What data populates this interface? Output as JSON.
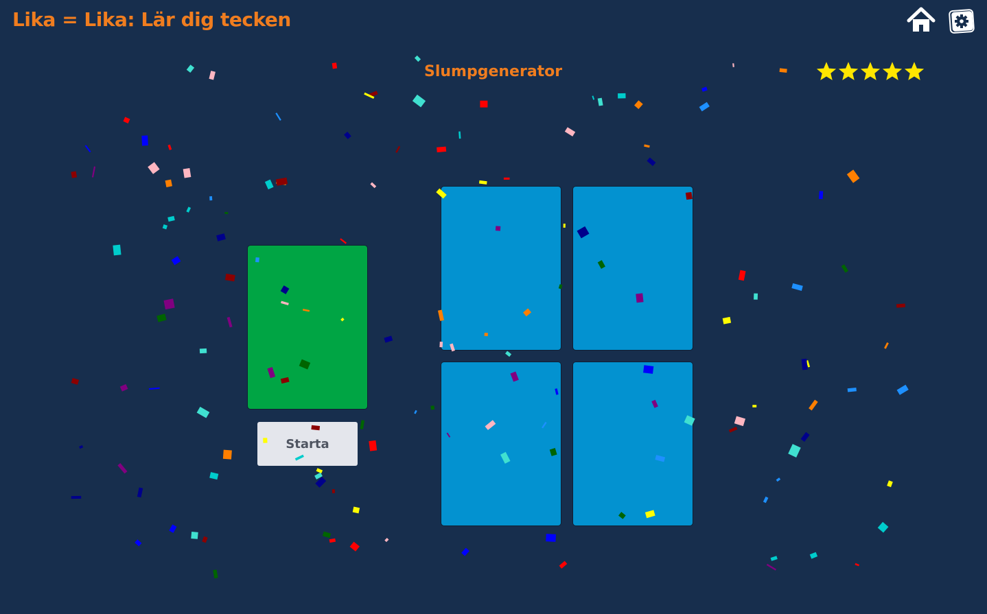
{
  "header": {
    "title": "Lika = Lika: Lär dig tecken",
    "home_icon": "home-icon",
    "settings_icon": "gear-icon"
  },
  "game": {
    "subtitle": "Slumpgenerator",
    "rating": {
      "filled_stars": 5,
      "max_stars": 5,
      "star_icon": "star-icon"
    },
    "start_label": "Starta",
    "colors": {
      "background": "#172e4d",
      "accent": "#f07d1f",
      "card_main": "#00a544",
      "card_grid": "#0392d0",
      "button": "#e4e6ec",
      "star": "#ffe600"
    },
    "confetti_colors": [
      "#ff7f00",
      "#ffff00",
      "#00cccc",
      "#40e0d0",
      "#ff0000",
      "#8b0000",
      "#006400",
      "#00008b",
      "#0000ff",
      "#800080",
      "#ffb6c1",
      "#1e90ff"
    ]
  }
}
